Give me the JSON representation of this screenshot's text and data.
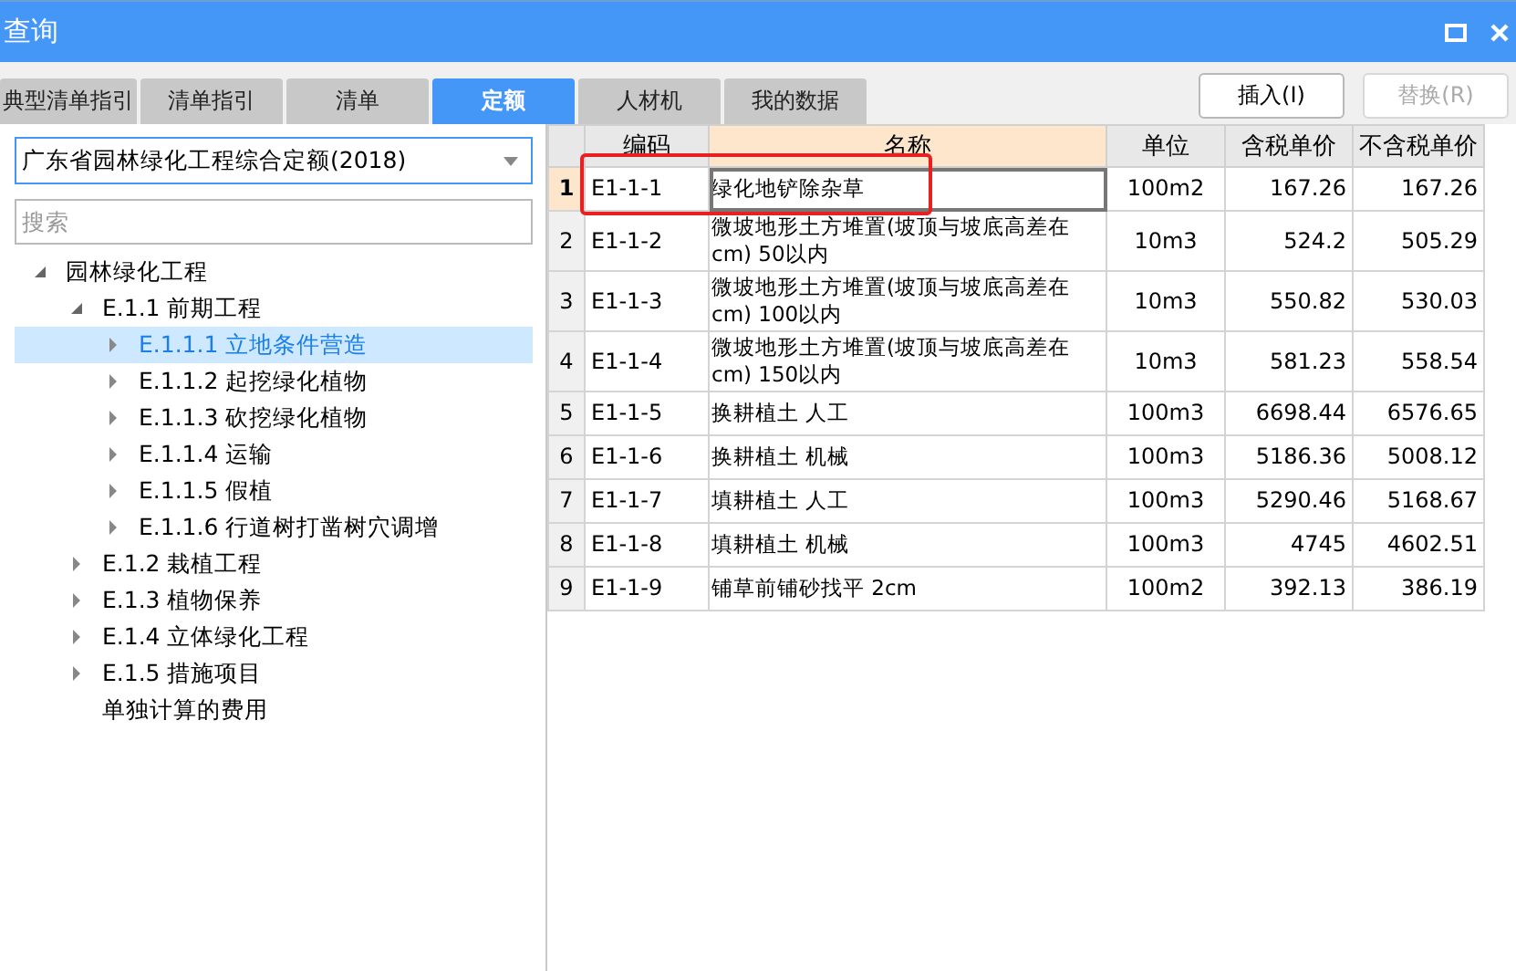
{
  "window": {
    "title": "查询"
  },
  "tabs": [
    {
      "label": "典型清单指引",
      "selected": false
    },
    {
      "label": "清单指引",
      "selected": false
    },
    {
      "label": "清单",
      "selected": false
    },
    {
      "label": "定额",
      "selected": true
    },
    {
      "label": "人材机",
      "selected": false
    },
    {
      "label": "我的数据",
      "selected": false
    }
  ],
  "buttons": [
    {
      "label": "插入(I)",
      "disabled": false
    },
    {
      "label": "替换(R)",
      "disabled": true
    }
  ],
  "library_select": {
    "value": "广东省园林绿化工程综合定额(2018)"
  },
  "search": {
    "placeholder": "搜索"
  },
  "tree": [
    {
      "label": "园林绿化工程",
      "expanded": true,
      "selected": false,
      "children": [
        {
          "label": "E.1.1 前期工程",
          "expanded": true,
          "selected": false,
          "children": [
            {
              "label": "E.1.1.1 立地条件营造",
              "expanded": false,
              "selected": true
            },
            {
              "label": "E.1.1.2 起挖绿化植物",
              "expanded": false,
              "selected": false
            },
            {
              "label": "E.1.1.3 砍挖绿化植物",
              "expanded": false,
              "selected": false
            },
            {
              "label": "E.1.1.4 运输",
              "expanded": false,
              "selected": false
            },
            {
              "label": "E.1.1.5 假植",
              "expanded": false,
              "selected": false
            },
            {
              "label": "E.1.1.6 行道树打凿树穴调增",
              "expanded": false,
              "selected": false
            }
          ]
        },
        {
          "label": "E.1.2 栽植工程",
          "expanded": false,
          "selected": false
        },
        {
          "label": "E.1.3 植物保养",
          "expanded": false,
          "selected": false
        },
        {
          "label": "E.1.4 立体绿化工程",
          "expanded": false,
          "selected": false
        },
        {
          "label": "E.1.5 措施项目",
          "expanded": false,
          "selected": false
        },
        {
          "label": "单独计算的费用",
          "leaf": true,
          "selected": false
        }
      ]
    }
  ],
  "table": {
    "columns": [
      "编码",
      "名称",
      "单位",
      "含税单价",
      "不含税单价"
    ],
    "rows": [
      {
        "index": "1",
        "code": "E1-1-1",
        "name": "绿化地铲除杂草",
        "unit": "100m2",
        "price_tax": "167.26",
        "price_notax": "167.26",
        "selected": true,
        "highlighted": true
      },
      {
        "index": "2",
        "code": "E1-1-2",
        "name": "微坡地形土方堆置(坡顶与坡底高差在cm) 50以内",
        "unit": "10m3",
        "price_tax": "524.2",
        "price_notax": "505.29",
        "selected": false,
        "highlighted": false
      },
      {
        "index": "3",
        "code": "E1-1-3",
        "name": "微坡地形土方堆置(坡顶与坡底高差在cm) 100以内",
        "unit": "10m3",
        "price_tax": "550.82",
        "price_notax": "530.03",
        "selected": false,
        "highlighted": false
      },
      {
        "index": "4",
        "code": "E1-1-4",
        "name": "微坡地形土方堆置(坡顶与坡底高差在cm) 150以内",
        "unit": "10m3",
        "price_tax": "581.23",
        "price_notax": "558.54",
        "selected": false,
        "highlighted": false
      },
      {
        "index": "5",
        "code": "E1-1-5",
        "name": "换耕植土 人工",
        "unit": "100m3",
        "price_tax": "6698.44",
        "price_notax": "6576.65",
        "selected": false,
        "highlighted": false
      },
      {
        "index": "6",
        "code": "E1-1-6",
        "name": "换耕植土 机械",
        "unit": "100m3",
        "price_tax": "5186.36",
        "price_notax": "5008.12",
        "selected": false,
        "highlighted": false
      },
      {
        "index": "7",
        "code": "E1-1-7",
        "name": "填耕植土 人工",
        "unit": "100m3",
        "price_tax": "5290.46",
        "price_notax": "5168.67",
        "selected": false,
        "highlighted": false
      },
      {
        "index": "8",
        "code": "E1-1-8",
        "name": "填耕植土 机械",
        "unit": "100m3",
        "price_tax": "4745",
        "price_notax": "4602.51",
        "selected": false,
        "highlighted": false
      },
      {
        "index": "9",
        "code": "E1-1-9",
        "name": "铺草前铺砂找平 2cm",
        "unit": "100m2",
        "price_tax": "392.13",
        "price_notax": "386.19",
        "selected": false,
        "highlighted": false
      }
    ]
  }
}
